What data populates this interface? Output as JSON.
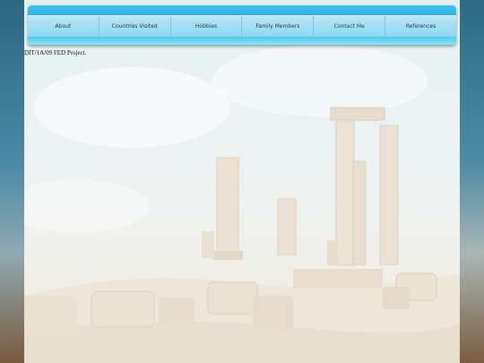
{
  "nav": {
    "items": [
      {
        "label": "About"
      },
      {
        "label": "Countries Visited"
      },
      {
        "label": "Hobbies"
      },
      {
        "label": "Family Members"
      },
      {
        "label": "Contact Me"
      },
      {
        "label": "References"
      }
    ]
  },
  "page": {
    "caption": "DIT/1A/09 FED Project."
  },
  "colors": {
    "nav_accent": "#1ea9e4",
    "nav_bar": "#a7e0f4"
  }
}
